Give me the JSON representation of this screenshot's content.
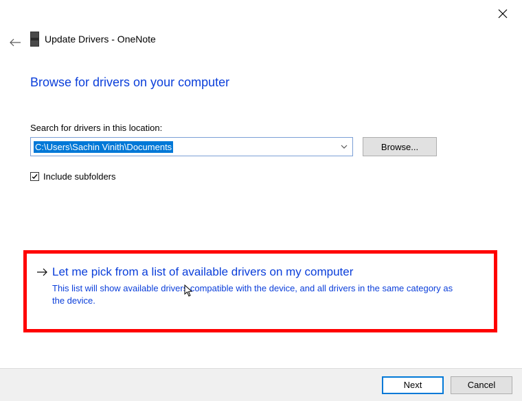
{
  "window": {
    "title": "Update Drivers - OneNote"
  },
  "main": {
    "heading": "Browse for drivers on your computer",
    "path_label": "Search for drivers in this location:",
    "path_value": "C:\\Users\\Sachin Vinith\\Documents",
    "browse_label": "Browse...",
    "subfolders_checked": true,
    "subfolders_label": "Include subfolders"
  },
  "option": {
    "title": "Let me pick from a list of available drivers on my computer",
    "description": "This list will show available drivers compatible with the device, and all drivers in the same category as the device."
  },
  "footer": {
    "next_label": "Next",
    "cancel_label": "Cancel"
  }
}
